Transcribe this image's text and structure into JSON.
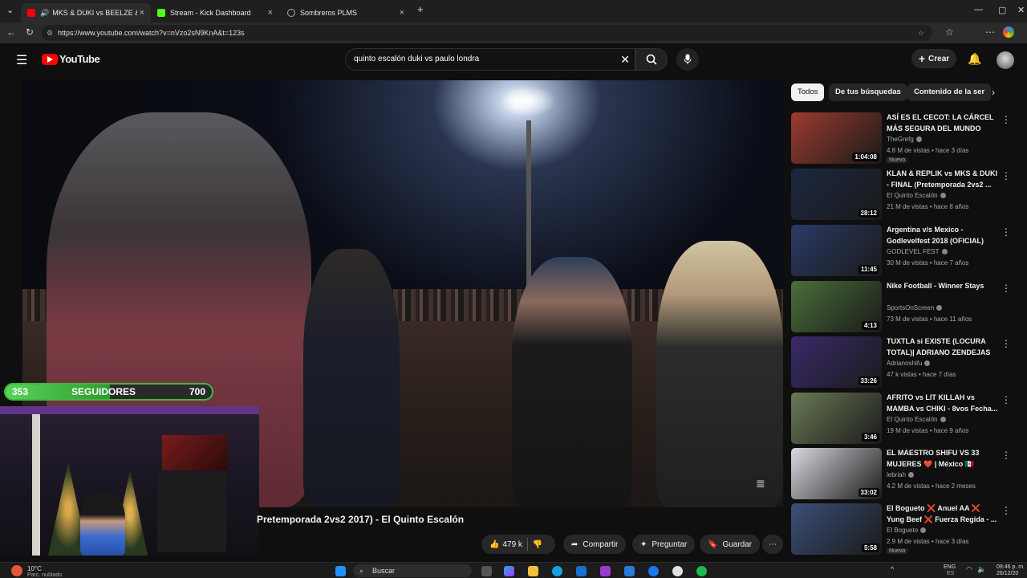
{
  "browser": {
    "tabs": [
      {
        "label": "MKS & DUKI vs BEELZE & PA"
      },
      {
        "label": "Stream - Kick Dashboard"
      },
      {
        "label": "Sombreros PLMS"
      }
    ],
    "url": "https://www.youtube.com/watch?v=nVzo2sN9KnA&t=123s"
  },
  "youtube": {
    "logo_text": "YouTube",
    "search_value": "quinto escalón duki vs paulo londra",
    "create_label": "Crear"
  },
  "overlay": {
    "followers_current": "353",
    "followers_label": "SEGUIDORES",
    "followers_goal": "700",
    "followers_progress": 0.504
  },
  "video": {
    "title_visible": "Pretemporada 2vs2 2017) - El Quinto Escalón",
    "likes": "479 k",
    "share_label": "Compartir",
    "ask_label": "Preguntar",
    "save_label": "Guardar"
  },
  "sidebar": {
    "chips": [
      "Todos",
      "De tus búsquedas",
      "Contenido de la ser"
    ],
    "recommendations": [
      {
        "title": "ASÍ ES EL CECOT: LA CÁRCEL MÁS SEGURA DEL MUNDO",
        "channel": "TheGrefg",
        "meta": "4.8 M de vistas • hace 3 días",
        "badge": "Nuevo",
        "duration": "1:04:08",
        "color": "#9c3b2f"
      },
      {
        "title": "KLAN & REPLIK vs MKS & DUKI - FINAL (Pretemporada 2vs2 ...",
        "channel": "El Quinto Escalón",
        "meta": "21 M de vistas • hace 8 años",
        "badge": "",
        "duration": "28:12",
        "color": "#1c2740"
      },
      {
        "title": "Argentina v/s Mexico - Godlevelfest 2018 (OFICIAL)",
        "channel": "GODLEVEL FEST",
        "meta": "30 M de vistas • hace 7 años",
        "badge": "",
        "duration": "11:45",
        "color": "#2b3a66"
      },
      {
        "title": "Nike Football - Winner Stays",
        "channel": "SportsOnScreen",
        "meta": "73 M de vistas • hace 11 años",
        "badge": "",
        "duration": "4:13",
        "color": "#4a6f3a"
      },
      {
        "title": "TUXTLA si EXISTE (LOCURA TOTAL)| ADRIANO ZENDEJAS",
        "channel": "Adrianoshifu",
        "meta": "47 k vistas • hace 7 días",
        "badge": "",
        "duration": "33:26",
        "color": "#3a2a6b"
      },
      {
        "title": "AFRITO vs LIT KILLAH vs MAMBA vs CHIKI - 8vos Fecha...",
        "channel": "El Quinto Escalón",
        "meta": "19 M de vistas • hace 9 años",
        "badge": "",
        "duration": "3:46",
        "color": "#6b7a55"
      },
      {
        "title": "EL MAESTRO SHIFU VS 33 MUJERES ❤️ | México 🇲🇽",
        "channel": "lebriah",
        "meta": "4.2 M de vistas • hace 2 meses",
        "badge": "",
        "duration": "33:02",
        "color": "#d9d9e0"
      },
      {
        "title": "El Bogueto ❌ Anuel AA ❌ Yung Beef ❌ Fuerza Regida - ...",
        "channel": "El Bogueto",
        "meta": "2.9 M de vistas • hace 3 días",
        "badge": "Nuevo",
        "duration": "5:58",
        "color": "#3b4f78"
      }
    ]
  },
  "taskbar": {
    "weather_temp": "10°C",
    "weather_desc": "Parc. nublado",
    "search_label": "Buscar",
    "lang": "ENG",
    "lang_sub": "ES",
    "time": "09:46 p. m.",
    "date": "26/12/20"
  },
  "colors": {
    "youtube_red": "#ff0000",
    "progress_green": "#3cbc3c",
    "background": "#0f0f0f"
  }
}
